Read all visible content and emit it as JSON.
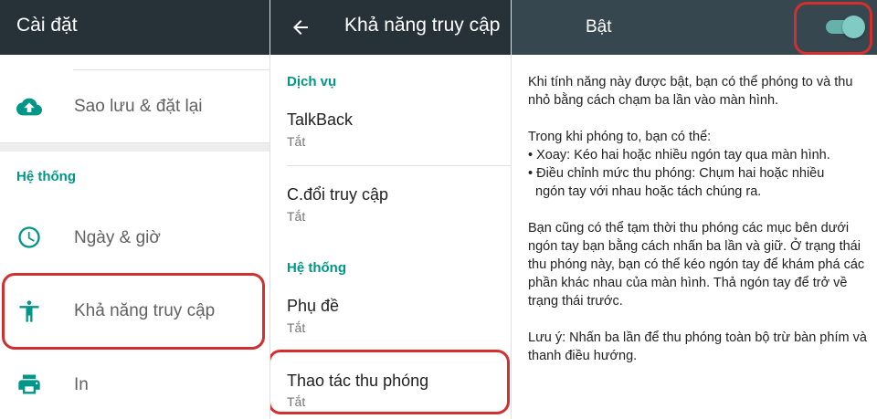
{
  "colors": {
    "appbar": "#263238",
    "appbar_right": "#37474f",
    "accent": "#009688",
    "highlight": "#d32f2f",
    "switch_on": "#80cbc4"
  },
  "settings": {
    "title": "Cài đặt",
    "backup": {
      "label": "Sao lưu & đặt lại",
      "icon": "cloud-upload-icon"
    },
    "section_system": "Hệ thống",
    "items": [
      {
        "label": "Ngày & giờ",
        "icon": "clock-icon"
      },
      {
        "label": "Khả năng truy cập",
        "icon": "accessibility-icon"
      },
      {
        "label": "In",
        "icon": "printer-icon"
      }
    ]
  },
  "accessibility": {
    "title": "Khả năng truy cập",
    "back_icon": "arrow-back-icon",
    "section_services": "Dịch vụ",
    "talkback": {
      "title": "TalkBack",
      "status": "Tắt"
    },
    "switch_access": {
      "title": "C.đổi truy cập",
      "status": "Tắt"
    },
    "section_system": "Hệ thống",
    "captions": {
      "title": "Phụ đề",
      "status": "Tắt"
    },
    "magnification": {
      "title": "Thao tác thu phóng",
      "status": "Tắt"
    }
  },
  "magnification_detail": {
    "toggle_label": "Bật",
    "toggle_on": true,
    "para1": "Khi tính năng này được bật, bạn có thể phóng to và thu nhỏ bằng cách chạm ba lần vào màn hình.",
    "para2_intro": "Trong khi phóng to, bạn có thể:",
    "bullet1": "• Xoay: Kéo hai hoặc nhiều ngón tay qua màn hình.",
    "bullet2_line1": "• Điều chỉnh mức thu phóng: Chụm hai hoặc nhiều",
    "bullet2_line2": "ngón tay với nhau hoặc tách chúng ra.",
    "para3": "Bạn cũng có thể tạm thời thu phóng các mục bên dưới ngón tay bạn bằng cách nhấn ba lần và giữ. Ở trạng thái thu phóng này, bạn có thể kéo ngón tay để khám phá các phần khác nhau của màn hình. Thả ngón tay để trở về trạng thái trước.",
    "para4": "Lưu ý: Nhấn ba lần để thu phóng toàn bộ trừ bàn phím và thanh điều hướng."
  }
}
